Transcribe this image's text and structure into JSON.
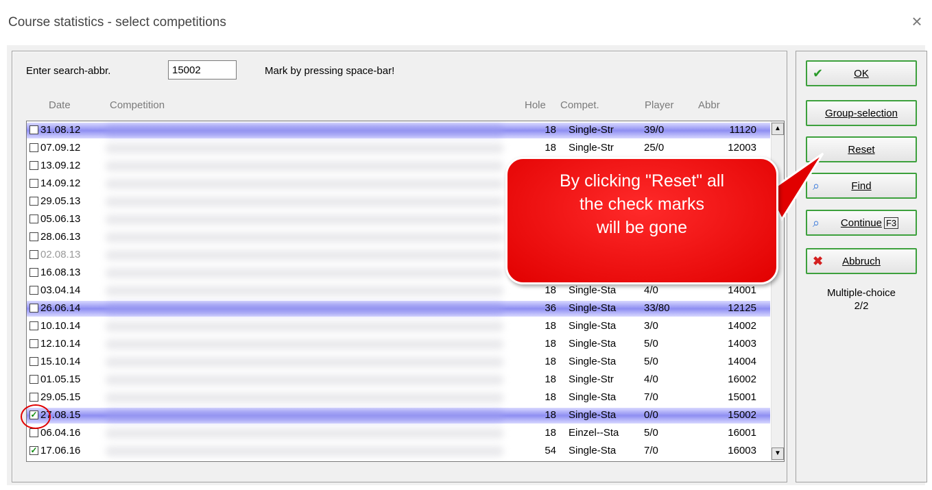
{
  "window": {
    "title": "Course statistics - select competitions",
    "close": "×"
  },
  "search": {
    "label": "Enter search-abbr.",
    "value": "15002",
    "hint": "Mark by pressing space-bar!"
  },
  "columns": {
    "date": "Date",
    "competition": "Competition",
    "hole": "Hole",
    "compet": "Compet.",
    "player": "Player",
    "abbr": "Abbr"
  },
  "rows": [
    {
      "date": "31.08.12",
      "hole": "18",
      "compet": "Single-Str",
      "player": "39/0",
      "abbr": "11120",
      "checked": false,
      "highlight": true
    },
    {
      "date": "07.09.12",
      "hole": "18",
      "compet": "Single-Str",
      "player": "25/0",
      "abbr": "12003",
      "checked": false
    },
    {
      "date": "13.09.12",
      "checked": false
    },
    {
      "date": "14.09.12",
      "checked": false
    },
    {
      "date": "29.05.13",
      "checked": false
    },
    {
      "date": "05.06.13",
      "checked": false
    },
    {
      "date": "28.06.13",
      "checked": false
    },
    {
      "date": "02.08.13",
      "checked": false,
      "grey": true
    },
    {
      "date": "16.08.13",
      "checked": false
    },
    {
      "date": "03.04.14",
      "hole": "18",
      "compet": "Single-Sta",
      "player": "4/0",
      "abbr": "14001",
      "checked": false
    },
    {
      "date": "26.06.14",
      "hole": "36",
      "compet": "Single-Sta",
      "player": "33/80",
      "abbr": "12125",
      "checked": false,
      "highlight": true
    },
    {
      "date": "10.10.14",
      "hole": "18",
      "compet": "Single-Sta",
      "player": "3/0",
      "abbr": "14002",
      "checked": false
    },
    {
      "date": "12.10.14",
      "hole": "18",
      "compet": "Single-Sta",
      "player": "5/0",
      "abbr": "14003",
      "checked": false
    },
    {
      "date": "15.10.14",
      "hole": "18",
      "compet": "Single-Sta",
      "player": "5/0",
      "abbr": "14004",
      "checked": false
    },
    {
      "date": "01.05.15",
      "hole": "18",
      "compet": "Single-Str",
      "player": "4/0",
      "abbr": "16002",
      "checked": false
    },
    {
      "date": "29.05.15",
      "hole": "18",
      "compet": "Single-Sta",
      "player": "7/0",
      "abbr": "15001",
      "checked": false
    },
    {
      "date": "27.08.15",
      "hole": "18",
      "compet": "Single-Sta",
      "player": "0/0",
      "abbr": "15002",
      "checked": true,
      "highlight": true
    },
    {
      "date": "06.04.16",
      "hole": "18",
      "compet": "Einzel--Sta",
      "player": "5/0",
      "abbr": "16001",
      "checked": false
    },
    {
      "date": "17.06.16",
      "hole": "54",
      "compet": "Single-Sta",
      "player": "7/0",
      "abbr": "16003",
      "checked": true
    }
  ],
  "buttons": {
    "ok": "OK",
    "group": "Group-selection",
    "reset": "Reset",
    "find": "Find",
    "continue": "Continue",
    "continue_key": "F3",
    "abbruch": "Abbruch"
  },
  "multiple_choice": {
    "label": "Multiple-choice",
    "value": "2/2"
  },
  "callout": {
    "line1": "By clicking \"Reset\" all",
    "line2": "the check marks",
    "line3": "will be gone"
  },
  "colors": {
    "highlight": "#8e8ef2",
    "callout": "#e10000",
    "button_border": "#3ca03c"
  }
}
